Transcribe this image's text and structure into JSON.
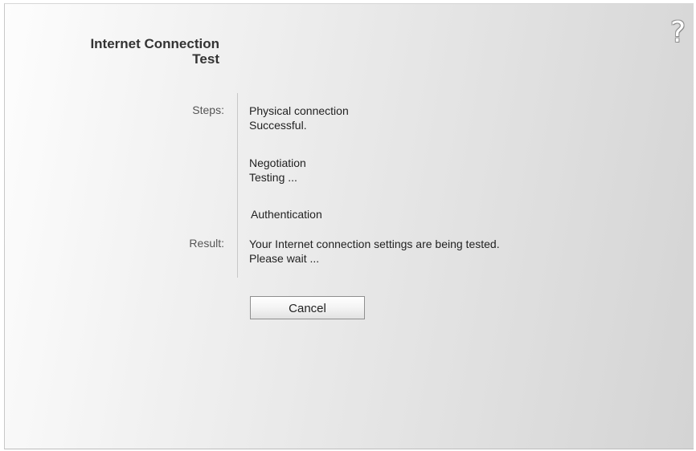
{
  "header": {
    "title_line1": "Internet Connection",
    "title_line2": "Test",
    "help_icon": "help-icon"
  },
  "steps": {
    "label": "Steps:",
    "items": [
      {
        "name": "Physical connection",
        "status": "Successful."
      },
      {
        "name": "Negotiation",
        "status": "Testing ..."
      },
      {
        "name": "Authentication",
        "status": ""
      }
    ]
  },
  "result": {
    "label": "Result:",
    "line1": "Your Internet connection settings are being tested.",
    "line2": "Please wait ..."
  },
  "actions": {
    "cancel_label": "Cancel"
  }
}
